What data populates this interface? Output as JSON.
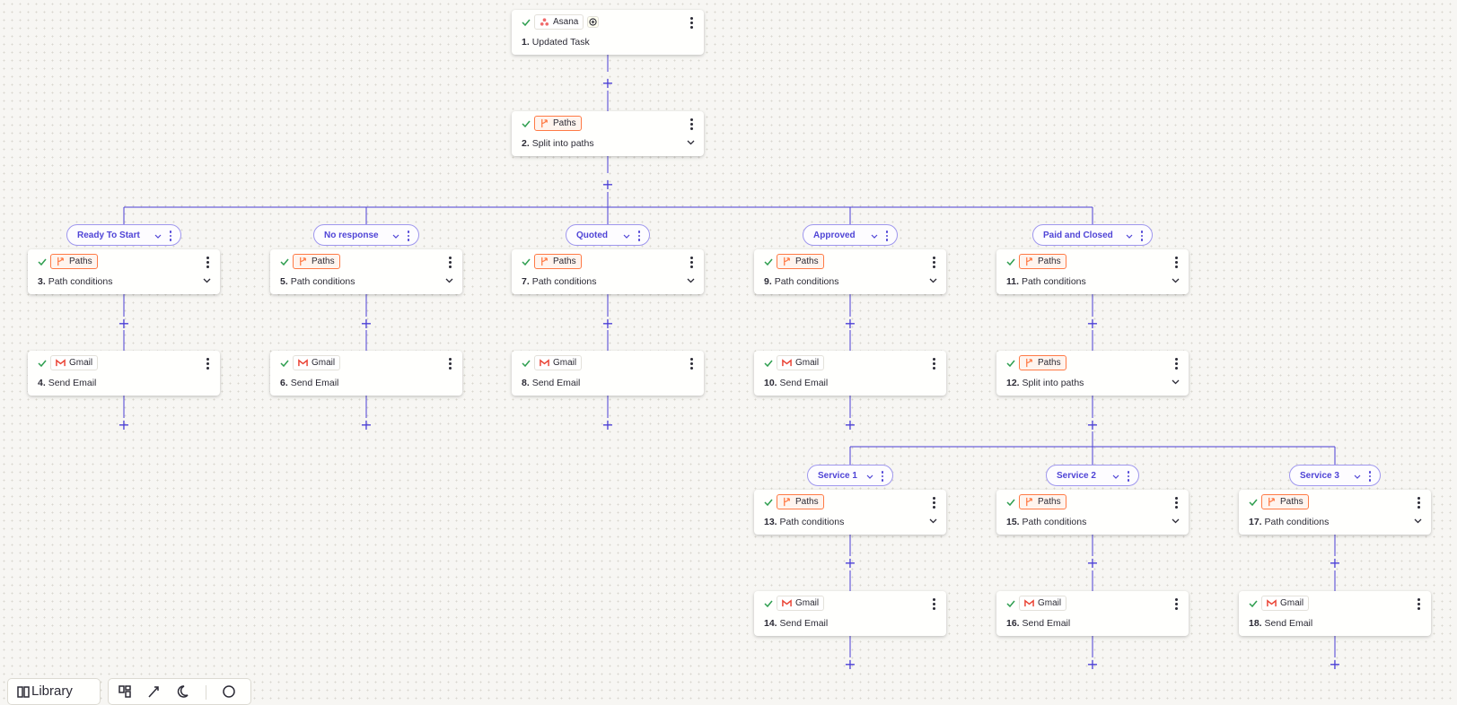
{
  "trigger": {
    "app": "Asana",
    "number": "1.",
    "title": "Updated Task"
  },
  "split_main": {
    "app": "Paths",
    "number": "2.",
    "title": "Split into paths"
  },
  "branches": [
    {
      "label": "Ready To Start",
      "condition": {
        "app": "Paths",
        "number": "3.",
        "title": "Path conditions"
      },
      "action": {
        "app": "Gmail",
        "number": "4.",
        "title": "Send Email"
      }
    },
    {
      "label": "No response",
      "condition": {
        "app": "Paths",
        "number": "5.",
        "title": "Path conditions"
      },
      "action": {
        "app": "Gmail",
        "number": "6.",
        "title": "Send Email"
      }
    },
    {
      "label": "Quoted",
      "condition": {
        "app": "Paths",
        "number": "7.",
        "title": "Path conditions"
      },
      "action": {
        "app": "Gmail",
        "number": "8.",
        "title": "Send Email"
      }
    },
    {
      "label": "Approved",
      "condition": {
        "app": "Paths",
        "number": "9.",
        "title": "Path conditions"
      },
      "action": {
        "app": "Gmail",
        "number": "10.",
        "title": "Send Email"
      }
    },
    {
      "label": "Paid and Closed",
      "condition": {
        "app": "Paths",
        "number": "11.",
        "title": "Path conditions"
      },
      "action": {
        "app": "Paths",
        "number": "12.",
        "title": "Split into paths"
      }
    }
  ],
  "sub_branches": [
    {
      "label": "Service 1",
      "condition": {
        "app": "Paths",
        "number": "13.",
        "title": "Path conditions"
      },
      "action": {
        "app": "Gmail",
        "number": "14.",
        "title": "Send Email"
      }
    },
    {
      "label": "Service 2",
      "condition": {
        "app": "Paths",
        "number": "15.",
        "title": "Path conditions"
      },
      "action": {
        "app": "Gmail",
        "number": "16.",
        "title": "Send Email"
      }
    },
    {
      "label": "Service 3",
      "condition": {
        "app": "Paths",
        "number": "17.",
        "title": "Path conditions"
      },
      "action": {
        "app": "Gmail",
        "number": "18.",
        "title": "Send Email"
      }
    }
  ],
  "toolbar": {
    "library_label": "Library"
  },
  "colors": {
    "connector": "#4b3fd6",
    "pill_border": "#9f97ee",
    "paths_accent": "#ff7a45",
    "check": "#2e9e4f",
    "gmail_red": "#ea4335",
    "asana_coral": "#f06a6a"
  },
  "icons": {
    "check": "check-icon",
    "paths": "paths-icon",
    "gmail": "gmail-icon",
    "asana": "asana-icon",
    "add": "add-circle-icon",
    "more": "kebab-icon",
    "expand": "chevron-down-icon"
  }
}
